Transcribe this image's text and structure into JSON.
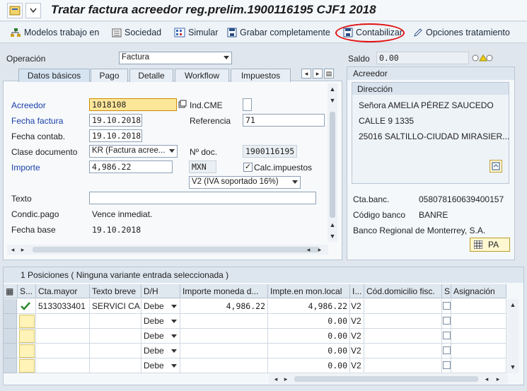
{
  "window": {
    "title": "Tratar factura acreedor reg.prelim.1900116195 CJF1 2018"
  },
  "toolbar": {
    "modelos": "Modelos trabajo en",
    "sociedad": "Sociedad",
    "simular": "Simular",
    "grabar": "Grabar completamente",
    "contabilizar": "Contabilizar",
    "opciones": "Opciones tratamiento"
  },
  "operacion": {
    "label": "Operación",
    "value": "Factura"
  },
  "saldo": {
    "label": "Saldo",
    "value": "0.00"
  },
  "tabs": [
    "Datos básicos",
    "Pago",
    "Detalle",
    "Workflow",
    "Impuestos"
  ],
  "basic": {
    "acreedor_label": "Acreedor",
    "acreedor_value": "1018108",
    "indcme_label": "Ind.CME",
    "fecha_factura_label": "Fecha factura",
    "fecha_factura_value": "19.10.2018",
    "referencia_label": "Referencia",
    "referencia_value": "71",
    "fecha_contab_label": "Fecha contab.",
    "fecha_contab_value": "19.10.2018",
    "clase_doc_label": "Clase documento",
    "clase_doc_value": "KR (Factura acree...",
    "ndoc_label": "Nº doc.",
    "ndoc_value": "1900116195",
    "importe_label": "Importe",
    "importe_value": "4,986.22",
    "currency": "MXN",
    "calc_label": "Calc.impuestos",
    "tax_value": "V2 (IVA soportado 16%)",
    "texto_label": "Texto",
    "texto_value": "",
    "condic_label": "Condic.pago",
    "condic_value": "Vence inmediat.",
    "fecha_base_label": "Fecha base",
    "fecha_base_value": "19.10.2018"
  },
  "vendor": {
    "section_title": "Acreedor",
    "dir_title": "Dirección",
    "addr1": "Señora AMELIA PÉREZ SAUCEDO",
    "addr2": "CALLE 9 1335",
    "addr3": "25016 SALTILLO-CIUDAD MIRASIER...",
    "ctabanc_label": "Cta.banc.",
    "ctabanc_value": "058078160639400157",
    "codbanco_label": "Código banco",
    "codbanco_value": "BANRE",
    "banco_name": "Banco Regional de Monterrey, S.A.",
    "pa_button": "PA"
  },
  "positions": {
    "title": "1 Posiciones ( Ninguna variante entrada seleccionada )",
    "headers": [
      "S...",
      "Cta.mayor",
      "Texto breve",
      "D/H",
      "Importe moneda d...",
      "Impte.en mon.local",
      "I...",
      "Cód.domicilio fisc.",
      "S",
      "Asignación"
    ],
    "rows": [
      {
        "cta": "5133033401",
        "texto": "SERVICI CA...",
        "dh": "Debe",
        "importe": "4,986.22",
        "local": "4,986.22",
        "ind": "V2"
      },
      {
        "cta": "",
        "texto": "",
        "dh": "Debe",
        "importe": "",
        "local": "0.00",
        "ind": "V2"
      },
      {
        "cta": "",
        "texto": "",
        "dh": "Debe",
        "importe": "",
        "local": "0.00",
        "ind": "V2"
      },
      {
        "cta": "",
        "texto": "",
        "dh": "Debe",
        "importe": "",
        "local": "0.00",
        "ind": "V2"
      },
      {
        "cta": "",
        "texto": "",
        "dh": "Debe",
        "importe": "",
        "local": "0.00",
        "ind": "V2"
      }
    ]
  },
  "colors": {
    "accent": "#1a3fa8",
    "highlight": "#ffe79a",
    "circle": "#e01212"
  }
}
